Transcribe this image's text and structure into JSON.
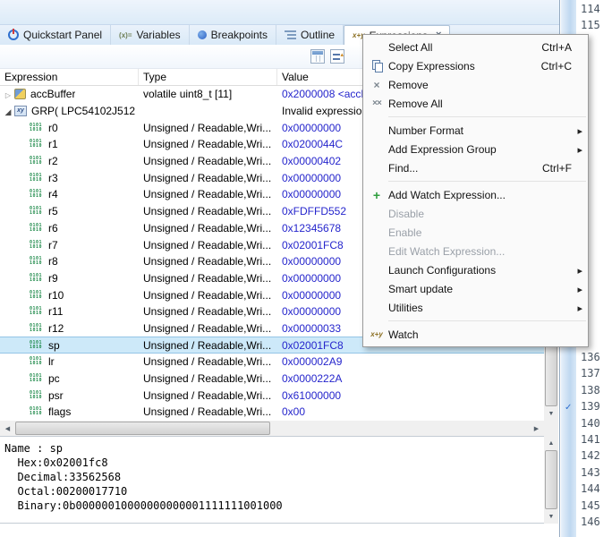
{
  "tabs": {
    "items": [
      {
        "label": "Quickstart Panel"
      },
      {
        "label": "Variables"
      },
      {
        "label": "Breakpoints"
      },
      {
        "label": "Outline"
      },
      {
        "label": "Expressions"
      }
    ]
  },
  "icons": {
    "variables_glyph": "(x)=",
    "expressions_glyph": "x+y",
    "group_glyph": "xy",
    "watch_glyph": "x+y",
    "close_glyph": "×",
    "x_glyph": "×",
    "xx_glyph": "××",
    "plus_glyph": "+"
  },
  "table": {
    "columns": {
      "expression": "Expression",
      "type": "Type",
      "value": "Value"
    }
  },
  "rows": [
    {
      "expression": "accBuffer",
      "type": "volatile uint8_t [11]",
      "value": "0x2000008 <accB..."
    },
    {
      "expression": "GRP( LPC54102J512",
      "type": "",
      "value": "Invalid expression"
    },
    {
      "expression": "r0",
      "type": "Unsigned / Readable,Wri...",
      "value": "0x00000000"
    },
    {
      "expression": "r1",
      "type": "Unsigned / Readable,Wri...",
      "value": "0x0200044C"
    },
    {
      "expression": "r2",
      "type": "Unsigned / Readable,Wri...",
      "value": "0x00000402"
    },
    {
      "expression": "r3",
      "type": "Unsigned / Readable,Wri...",
      "value": "0x00000000"
    },
    {
      "expression": "r4",
      "type": "Unsigned / Readable,Wri...",
      "value": "0x00000000"
    },
    {
      "expression": "r5",
      "type": "Unsigned / Readable,Wri...",
      "value": "0xFDFFD552"
    },
    {
      "expression": "r6",
      "type": "Unsigned / Readable,Wri...",
      "value": "0x12345678"
    },
    {
      "expression": "r7",
      "type": "Unsigned / Readable,Wri...",
      "value": "0x02001FC8"
    },
    {
      "expression": "r8",
      "type": "Unsigned / Readable,Wri...",
      "value": "0x00000000"
    },
    {
      "expression": "r9",
      "type": "Unsigned / Readable,Wri...",
      "value": "0x00000000"
    },
    {
      "expression": "r10",
      "type": "Unsigned / Readable,Wri...",
      "value": "0x00000000"
    },
    {
      "expression": "r11",
      "type": "Unsigned / Readable,Wri...",
      "value": "0x00000000"
    },
    {
      "expression": "r12",
      "type": "Unsigned / Readable,Wri...",
      "value": "0x00000033"
    },
    {
      "expression": "sp",
      "type": "Unsigned / Readable,Wri...",
      "value": "0x02001FC8",
      "selected": true
    },
    {
      "expression": "lr",
      "type": "Unsigned / Readable,Wri...",
      "value": "0x000002A9"
    },
    {
      "expression": "pc",
      "type": "Unsigned / Readable,Wri...",
      "value": "0x0000222A"
    },
    {
      "expression": "psr",
      "type": "Unsigned / Readable,Wri...",
      "value": "0x61000000"
    },
    {
      "expression": "flags",
      "type": "Unsigned / Readable,Wri...",
      "value": "0x00"
    }
  ],
  "menu": {
    "items": [
      {
        "label": "Select All",
        "shortcut": "Ctrl+A"
      },
      {
        "label": "Copy Expressions",
        "shortcut": "Ctrl+C"
      },
      {
        "label": "Remove"
      },
      {
        "label": "Remove All"
      },
      {
        "label": "Number Format",
        "submenu": true
      },
      {
        "label": "Add Expression Group",
        "submenu": true
      },
      {
        "label": "Find...",
        "shortcut": "Ctrl+F"
      },
      {
        "label": "Add Watch Expression..."
      },
      {
        "label": "Disable",
        "disabled": true
      },
      {
        "label": "Enable",
        "disabled": true
      },
      {
        "label": "Edit Watch Expression...",
        "disabled": true
      },
      {
        "label": "Launch Configurations",
        "submenu": true
      },
      {
        "label": "Smart update",
        "submenu": true
      },
      {
        "label": "Utilities",
        "submenu": true
      },
      {
        "label": "Watch"
      }
    ]
  },
  "detail": {
    "lines": [
      "Name : sp",
      "  Hex:0x02001fc8",
      "  Decimal:33562568",
      "  Octal:00200017710",
      "  Binary:0b00000010000000000001111111001000"
    ]
  },
  "gutter": {
    "top": [
      "114",
      "115"
    ],
    "bottom": [
      "136",
      "137",
      "138",
      "139",
      "140",
      "141",
      "142",
      "143",
      "144",
      "145",
      "146"
    ]
  }
}
